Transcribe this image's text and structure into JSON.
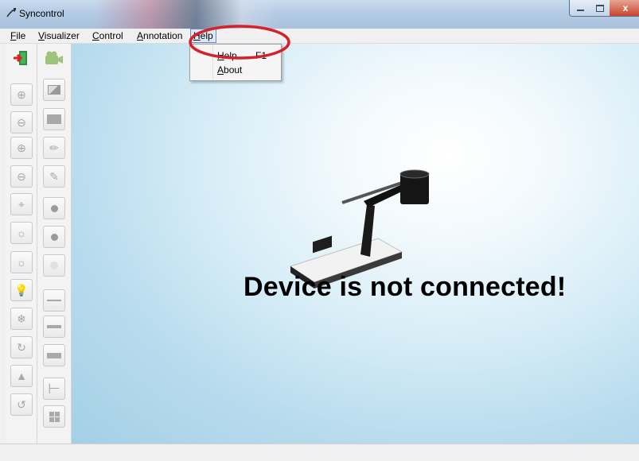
{
  "window": {
    "title": "Syncontrol",
    "icon": "syncontrol-app-icon",
    "controls": {
      "minimize": "minimize-icon",
      "maximize": "maximize-icon",
      "close_label": "x"
    }
  },
  "menubar": {
    "items": [
      {
        "label": "File",
        "mnemonic": "F",
        "rest": "ile"
      },
      {
        "label": "Visualizer",
        "mnemonic": "V",
        "rest": "isualizer"
      },
      {
        "label": "Control",
        "mnemonic": "C",
        "rest": "ontrol"
      },
      {
        "label": "Annotation",
        "mnemonic": "A",
        "rest": "nnotation"
      },
      {
        "label": "Help",
        "mnemonic": "H",
        "rest": "elp",
        "open": true
      }
    ]
  },
  "help_menu": {
    "items": [
      {
        "label": "Help",
        "mnemonic": "H",
        "rest": "elp",
        "shortcut": "F1"
      },
      {
        "label": "About",
        "mnemonic": "A",
        "rest": "bout",
        "shortcut": ""
      }
    ]
  },
  "toolbar_left": {
    "icons": [
      "exit-icon",
      "zoom-in-icon",
      "zoom-out-icon",
      "focus-plus-icon",
      "focus-minus-icon",
      "auto-focus-icon",
      "brightness-up-icon",
      "brightness-down-icon",
      "lamp-icon",
      "freeze-icon",
      "rotate-view-icon",
      "mirror-icon",
      "reset-icon"
    ]
  },
  "toolbar_right": {
    "icons": [
      "camera-icon",
      "snapshot-icon",
      "fit-screen-icon",
      "pen-icon",
      "eraser-icon",
      "dot-small-icon",
      "dot-medium-icon",
      "dot-large-icon",
      "line-thin-icon",
      "line-medium-icon",
      "line-thick-icon",
      "text-tool-icon",
      "grid-icon"
    ]
  },
  "main": {
    "message": "Device is not connected!",
    "illustration": "document-camera-image",
    "background_colors": {
      "center": "#ffffff",
      "edge": "#a4cfe6"
    }
  },
  "annotation": {
    "color": "#d6202a",
    "shape": "ellipse-around-help-menu"
  }
}
